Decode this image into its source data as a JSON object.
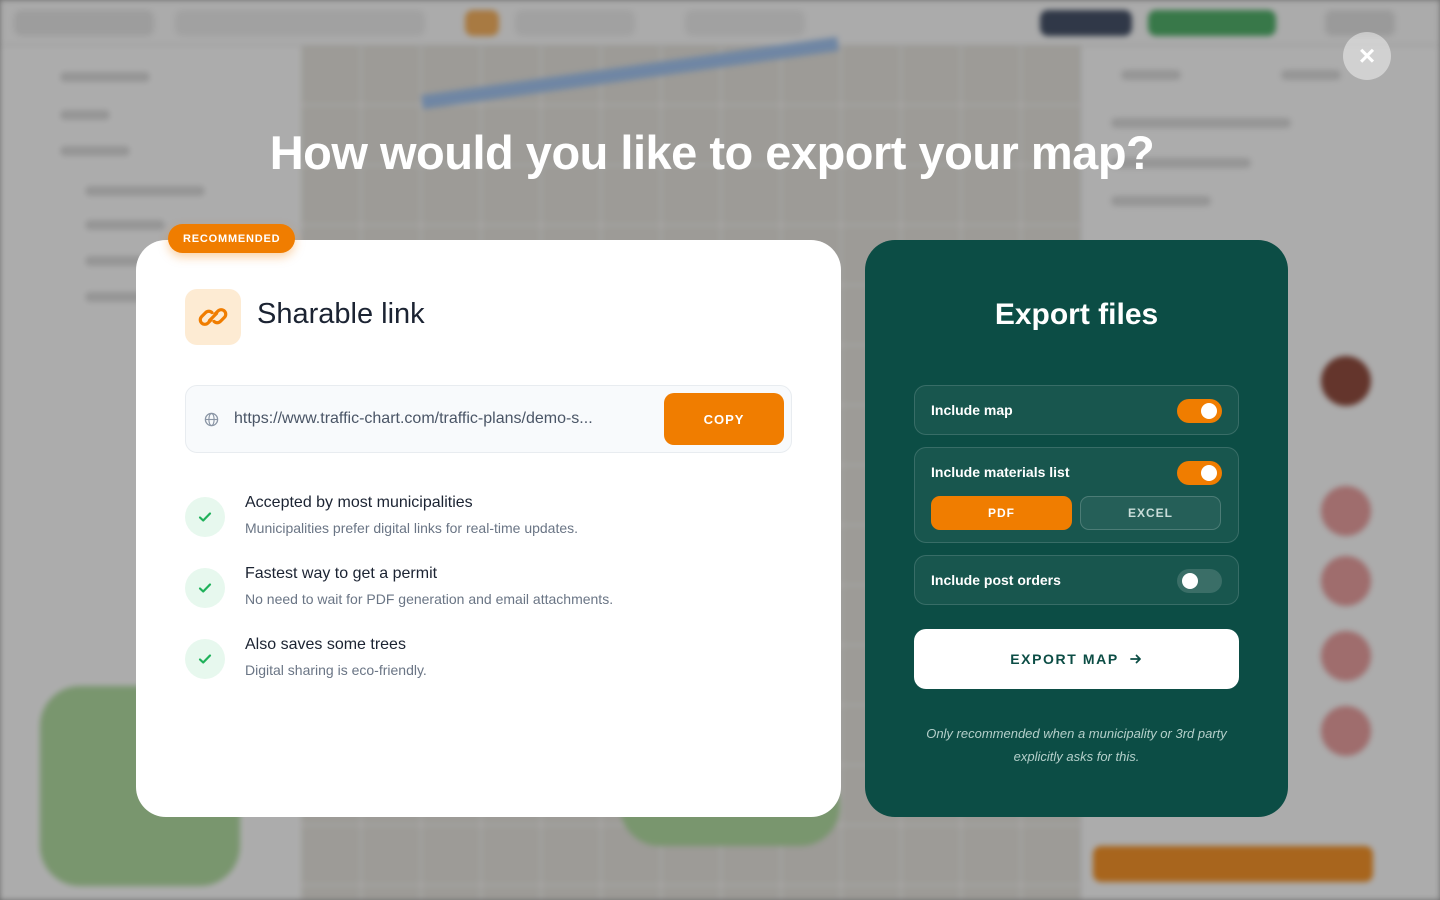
{
  "modal": {
    "title": "How would you like to export your map?",
    "close_label": "×"
  },
  "link_card": {
    "badge": "RECOMMENDED",
    "title": "Sharable link",
    "url": "https://www.traffic-chart.com/traffic-plans/demo-s...",
    "copy_label": "COPY",
    "benefits": [
      {
        "title": "Accepted by most municipalities",
        "description": "Municipalities prefer digital links for real-time updates."
      },
      {
        "title": "Fastest way to get a permit",
        "description": "No need to wait for PDF generation and email attachments."
      },
      {
        "title": "Also saves some trees",
        "description": "Digital sharing is eco-friendly."
      }
    ]
  },
  "export_card": {
    "title": "Export files",
    "options": [
      {
        "label": "Include map",
        "enabled": true
      },
      {
        "label": "Include materials list",
        "enabled": true
      },
      {
        "label": "Include post orders",
        "enabled": false
      }
    ],
    "formats": {
      "selected": "PDF",
      "pdf_label": "PDF",
      "excel_label": "EXCEL"
    },
    "export_button": "EXPORT MAP",
    "note": "Only recommended when a municipality or 3rd party explicitly asks for this."
  },
  "colors": {
    "accent": "#f07d00",
    "export_card_bg": "#0c4d45",
    "check_green": "#1fb15a"
  }
}
